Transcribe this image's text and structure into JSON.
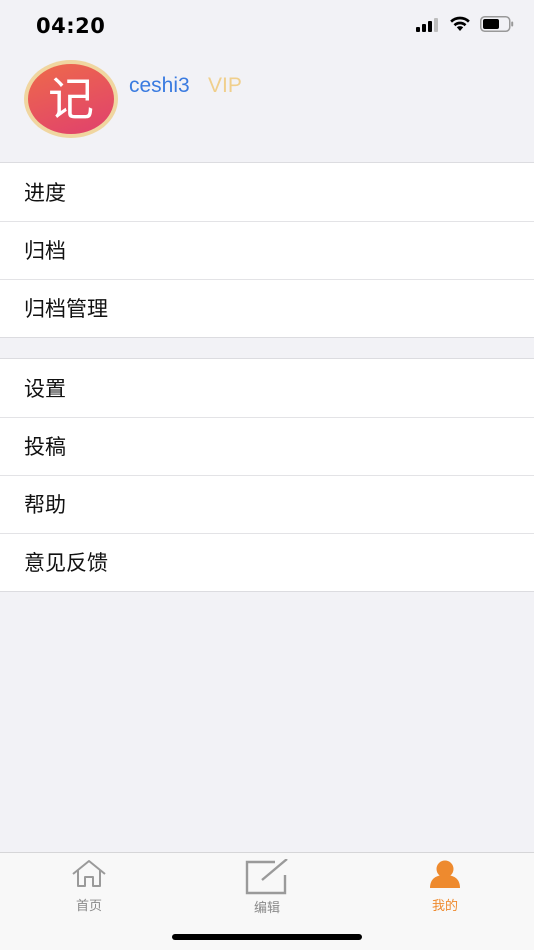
{
  "status_bar": {
    "time": "04:20",
    "icons": [
      "signal-icon",
      "wifi-icon",
      "battery-icon"
    ]
  },
  "profile": {
    "avatar_char": "记",
    "username": "ceshi3",
    "badge": "VIP",
    "colors": {
      "username": "#3a7be0",
      "badge": "#f0cf8c",
      "avatar": "#e0406e"
    }
  },
  "menu_group_1": {
    "items": [
      {
        "label": "进度"
      },
      {
        "label": "归档"
      },
      {
        "label": "归档管理"
      }
    ]
  },
  "menu_group_2": {
    "items": [
      {
        "label": "设置"
      },
      {
        "label": "投稿"
      },
      {
        "label": "帮助"
      },
      {
        "label": "意见反馈"
      }
    ]
  },
  "tab_bar": {
    "tabs": [
      {
        "label": "首页",
        "icon": "home-icon"
      },
      {
        "label": "编辑",
        "icon": "edit-icon"
      },
      {
        "label": "我的",
        "icon": "person-icon",
        "active": true
      }
    ],
    "active_color": "#ee8a2e"
  }
}
